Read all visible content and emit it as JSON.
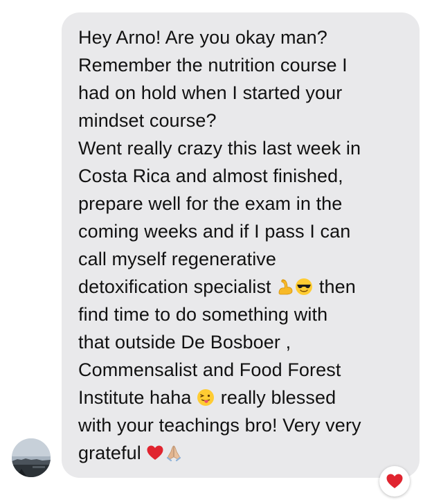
{
  "message": {
    "lines": [
      "Hey Arno! Are you okay man?",
      "Remember the nutrition course I",
      "had on hold when I started your",
      "mindset course?",
      "Went really crazy this last week in",
      "Costa Rica and almost finished,",
      "prepare well for the exam in the",
      "coming weeks and if I pass I can",
      "call myself regenerative",
      "detoxification specialist",
      "then",
      "find time to do something with",
      "that outside De Bosboer ,",
      "Commensalist and Food Forest",
      "Institute haha",
      "really blessed",
      "with your teachings bro! Very very",
      "grateful"
    ],
    "emojis": [
      "flexed-biceps-icon",
      "sunglasses-face-icon",
      "tongue-out-face-icon",
      "red-heart-icon",
      "folded-hands-icon"
    ]
  },
  "reaction": {
    "icon": "red-heart-icon"
  },
  "colors": {
    "bubble": "#e9e9eb",
    "text": "#111111",
    "heart": "#e0242f"
  }
}
